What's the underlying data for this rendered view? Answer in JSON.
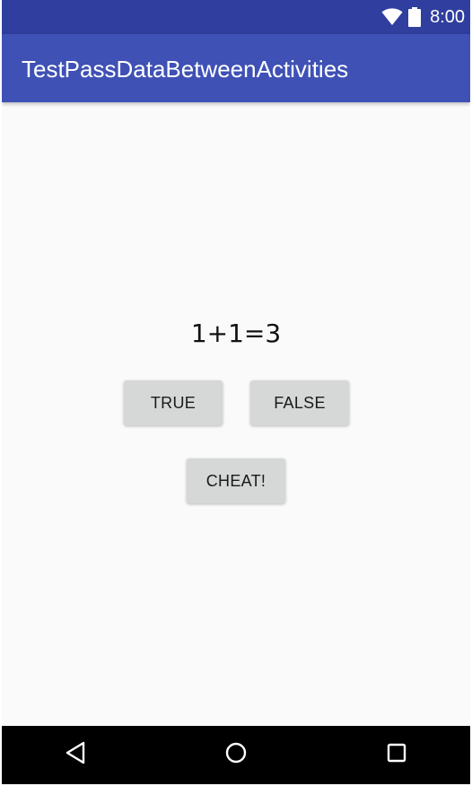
{
  "status_bar": {
    "time": "8:00",
    "icons": [
      "wifi-icon",
      "battery-icon"
    ]
  },
  "app_bar": {
    "title": "TestPassDataBetweenActivities"
  },
  "main": {
    "question": "1+1=3",
    "true_label": "TRUE",
    "false_label": "FALSE",
    "cheat_label": "CHEAT!"
  },
  "nav_bar": {
    "icons": [
      "back-icon",
      "home-icon",
      "recents-icon"
    ]
  },
  "colors": {
    "status_bar": "#303f9f",
    "app_bar": "#3f51b5",
    "background": "#fafafa",
    "button": "#d6d7d7",
    "nav_bar": "#000000"
  }
}
